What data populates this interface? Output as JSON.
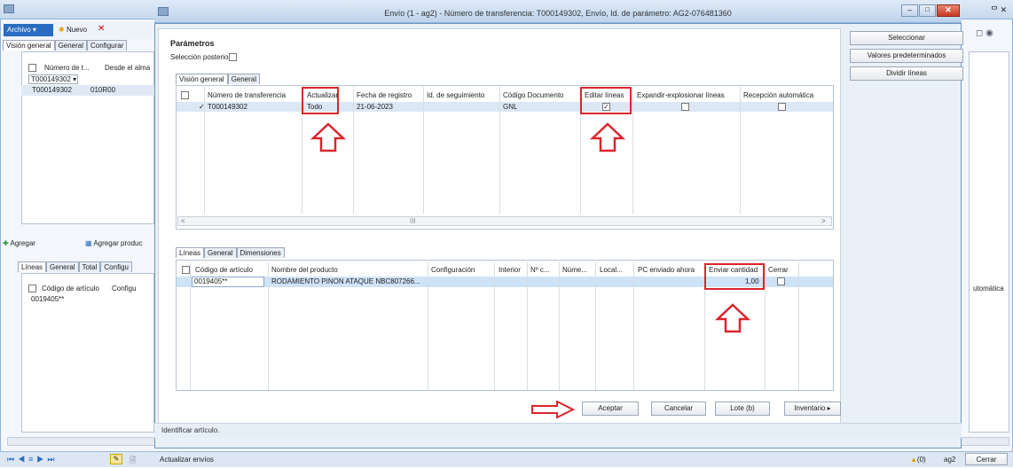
{
  "background_window": {
    "archivo_label": "Archivo",
    "nuevo_label": "Nuevo",
    "tabs": [
      "Visión general",
      "General",
      "Configurar"
    ],
    "columns": [
      "Número de t...",
      "Desde el alma"
    ],
    "filter_value": "T000149302",
    "row": {
      "numero": "T000149302",
      "almacen": "010R00"
    },
    "agregar_label": "Agregar",
    "agregar_productos_label": "Agregar produc",
    "lines_tabs": [
      "Líneas",
      "General",
      "Total",
      "Configu"
    ],
    "lines_columns": [
      "Código de artículo",
      "Configu"
    ],
    "lines_row_code": "0019405**",
    "right_header": "utomática"
  },
  "dialog": {
    "title": "Envío (1 - ag2) - Número de transferencia: T000149302, Envío, Id. de parámetro: AG2-076481360",
    "parametros_label": "Parámetros",
    "seleccion_posterior_label": "Selección posterior:",
    "top_tabs": [
      "Visión general",
      "General"
    ],
    "top_columns": [
      "Número de transferencia",
      "Actualizar",
      "Fecha de registro",
      "Id. de seguimiento",
      "Código Documento",
      "Editar líneas",
      "Expandir-explosionar líneas",
      "Recepción automática"
    ],
    "top_row": {
      "numero": "T000149302",
      "actualizar": "Todo",
      "fecha": "21-06-2023",
      "codigo_doc": "GNL",
      "editar_lineas": true,
      "expandir": false,
      "recepcion": false
    },
    "scroll_mid": "III",
    "lines_tabs": [
      "Líneas",
      "General",
      "Dimensiones"
    ],
    "lines_columns": [
      "Código de artículo",
      "Nombre del producto",
      "Configuración",
      "Interior",
      "Nº c...",
      "Núme...",
      "Local...",
      "PC enviado ahora",
      "Enviar cantidad",
      "Cerrar"
    ],
    "lines_row": {
      "codigo": "0019405**",
      "nombre": "RODAMIENTO PINON ATAQUE NBC807266...",
      "cantidad": "1,00",
      "cerrar": false
    },
    "buttons": {
      "aceptar": "Aceptar",
      "cancelar": "Cancelar",
      "lote": "Lote (b)",
      "inventario": "Inventario"
    },
    "status_text": "Identificar artículo."
  },
  "right_buttons": [
    "Seleccionar",
    "Valores predeterminados",
    "Dividir líneas"
  ],
  "statusbar": {
    "label": "Actualizar envíos",
    "count": "(0)",
    "company": "ag2",
    "cerrar": "Cerrar"
  },
  "colors": {
    "highlight": "#d9262c",
    "selection_row": "#cfe3f7",
    "title_blue": "#2a6cc0"
  }
}
